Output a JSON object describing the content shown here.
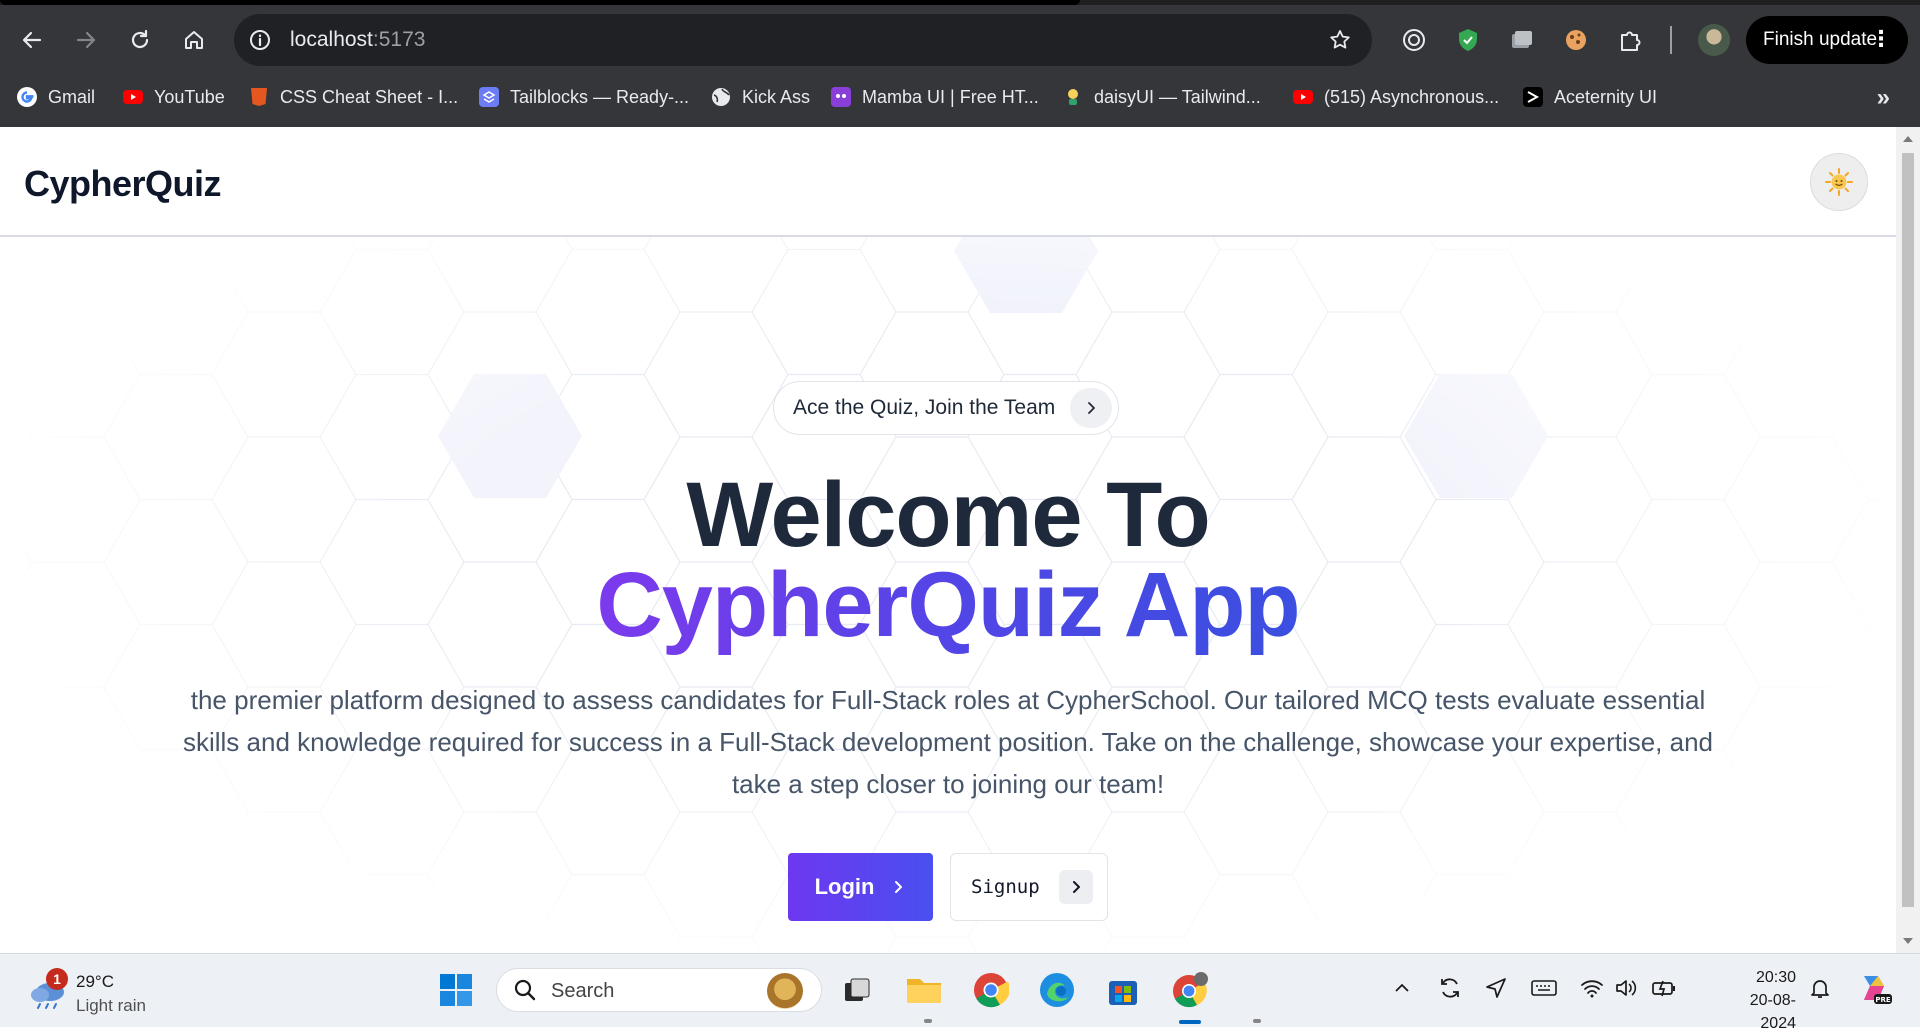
{
  "browser": {
    "url_host": "localhost",
    "url_port": ":5173",
    "finish_update_label": "Finish update",
    "bookmarks": [
      {
        "label": "Gmail",
        "icon": "google-icon"
      },
      {
        "label": "YouTube",
        "icon": "youtube-icon"
      },
      {
        "label": "CSS Cheat Sheet - I...",
        "icon": "css-icon"
      },
      {
        "label": "Tailblocks — Ready-...",
        "icon": "tailblocks-icon"
      },
      {
        "label": "Kick Ass",
        "icon": "globe-icon"
      },
      {
        "label": "Mamba UI | Free HT...",
        "icon": "mamba-icon"
      },
      {
        "label": "daisyUI — Tailwind...",
        "icon": "daisyui-icon"
      },
      {
        "label": "(515) Asynchronous...",
        "icon": "youtube-icon"
      },
      {
        "label": "Aceternity UI",
        "icon": "aceternity-icon"
      }
    ],
    "more_bookmarks": "»"
  },
  "site": {
    "brand": "CypherQuiz",
    "announcement": "Ace the Quiz, Join the Team",
    "headline_line1": "Welcome To",
    "headline_line2": "CypherQuiz App",
    "description": "the premier platform designed to assess candidates for Full-Stack roles at CypherSchool. Our tailored MCQ tests evaluate essential skills and knowledge required for success in a Full-Stack development position. Take on the challenge, showcase your expertise, and take a step closer to joining our team!",
    "login_label": "Login",
    "signup_label": "Signup",
    "colors": {
      "accent_start": "#7c3aed",
      "accent_end": "#3b4fe0",
      "heading": "#1e293b"
    }
  },
  "taskbar": {
    "weather_temp": "29°C",
    "weather_condition": "Light rain",
    "weather_badge": "1",
    "search_placeholder": "Search",
    "time": "20:30",
    "date": "20-08-2024"
  }
}
